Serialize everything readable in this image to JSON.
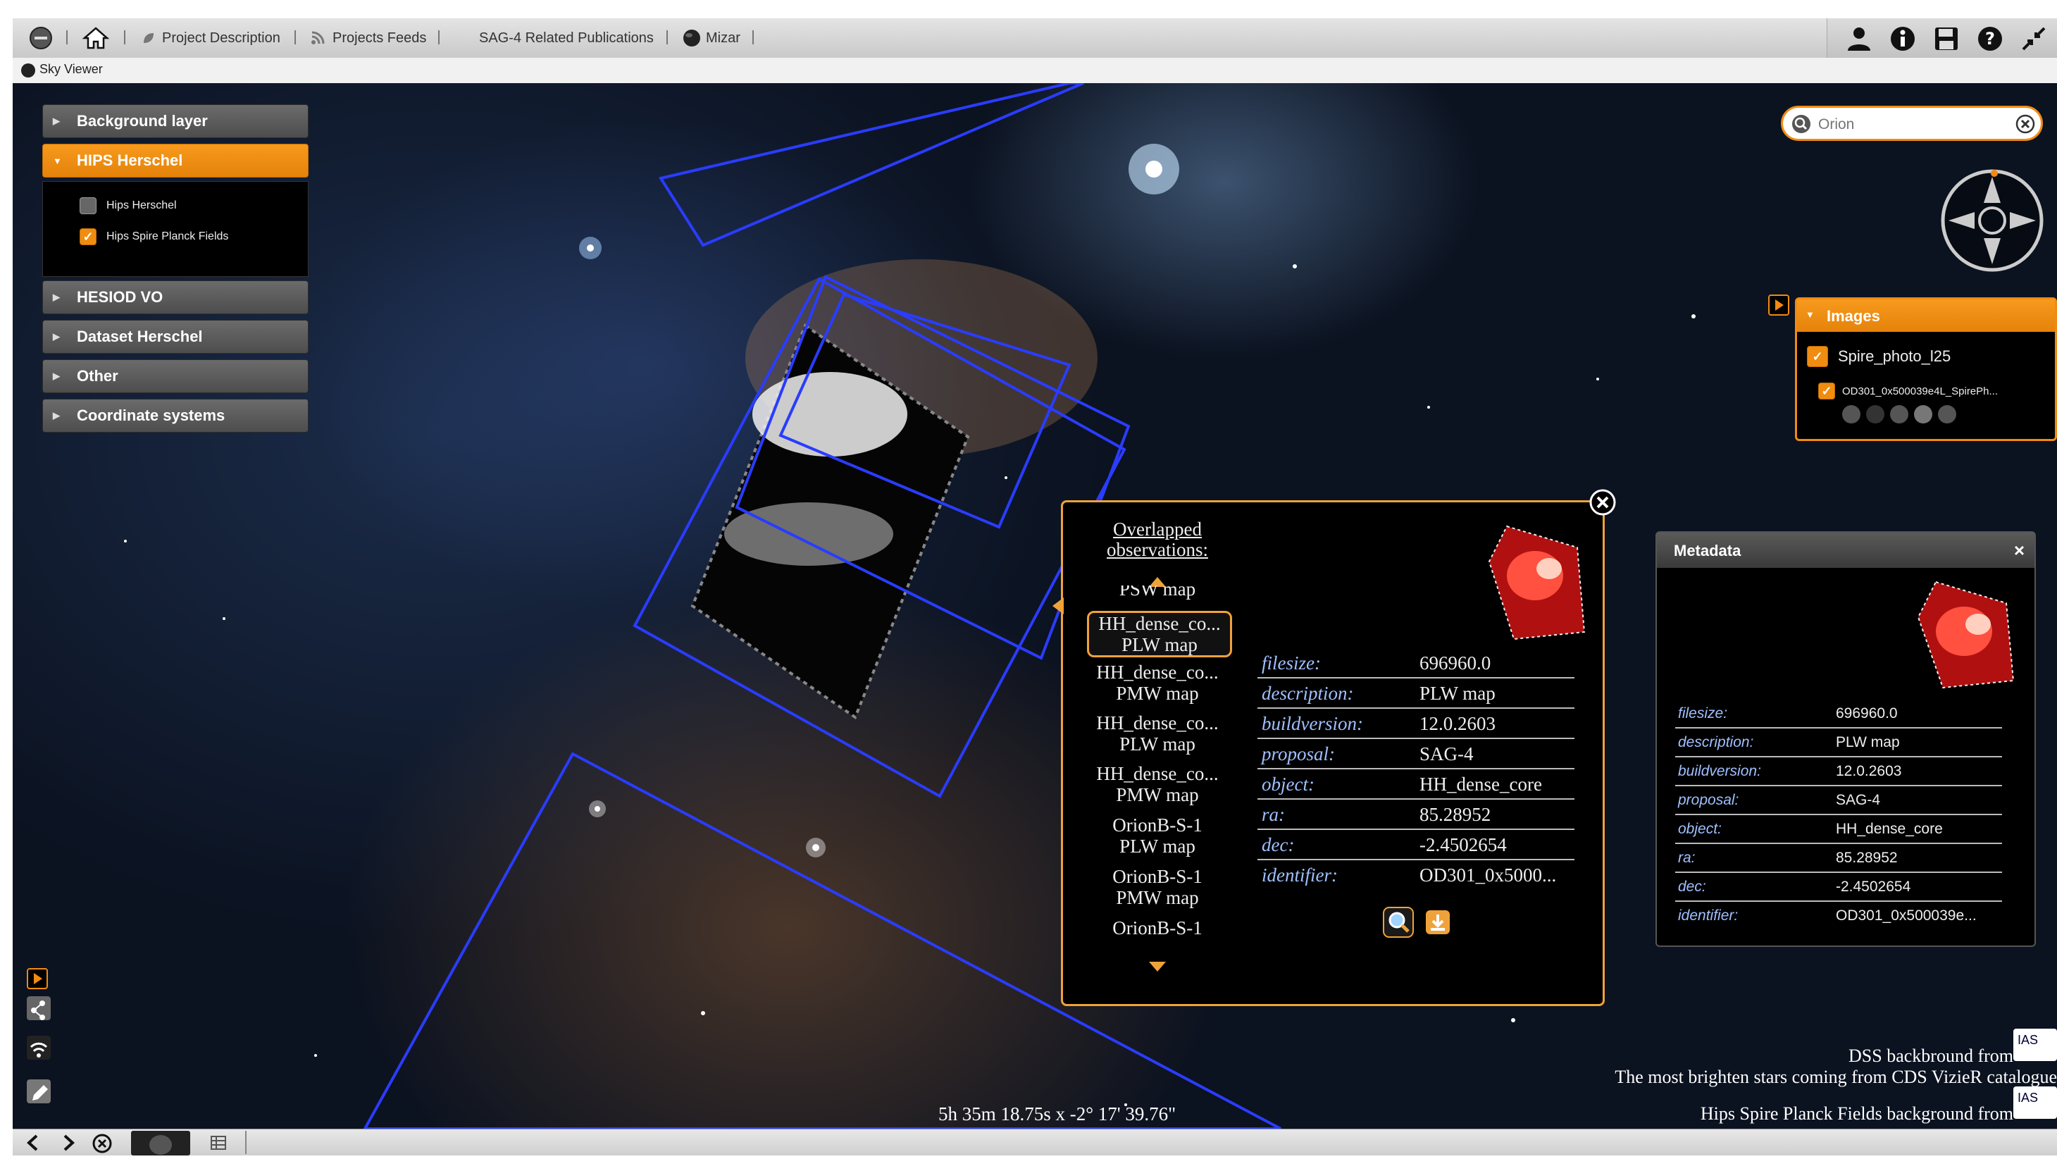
{
  "toolbar": {
    "nav": [
      {
        "label": "Project Description",
        "icon": "leaf-icon"
      },
      {
        "label": "Projects Feeds",
        "icon": "rss-icon"
      },
      {
        "label": "SAG-4 Related Publications",
        "icon": ""
      },
      {
        "label": "Mizar",
        "icon": "globe-icon"
      }
    ],
    "right_icons": [
      "user-icon",
      "info-icon",
      "save-icon",
      "help-icon",
      "fullscreen-icon"
    ]
  },
  "subbar": {
    "label": "Sky Viewer"
  },
  "layers": {
    "items": [
      {
        "label": "Background layer",
        "expanded": false
      },
      {
        "label": "HIPS Herschel",
        "expanded": true
      },
      {
        "label": "HESIOD VO",
        "expanded": false
      },
      {
        "label": "Dataset Herschel",
        "expanded": false
      },
      {
        "label": "Other",
        "expanded": false
      },
      {
        "label": "Coordinate systems",
        "expanded": false
      }
    ],
    "hips_children": [
      {
        "label": "Hips Herschel",
        "checked": false
      },
      {
        "label": "Hips Spire Planck Fields",
        "checked": true
      }
    ]
  },
  "search": {
    "placeholder": "Orion"
  },
  "images_panel": {
    "title": "Images",
    "group": "Spire_photo_l25",
    "item": "OD301_0x500039e4L_SpirePh..."
  },
  "popup": {
    "title": "Overlapped observations:",
    "list": [
      {
        "line1": "PSW map",
        "line2": "",
        "selected": false,
        "partial": true
      },
      {
        "line1": "HH_dense_co...",
        "line2": "PLW map",
        "selected": true
      },
      {
        "line1": "HH_dense_co...",
        "line2": "PMW map",
        "selected": false
      },
      {
        "line1": "HH_dense_co...",
        "line2": "PLW map",
        "selected": false
      },
      {
        "line1": "HH_dense_co...",
        "line2": "PMW map",
        "selected": false
      },
      {
        "line1": "OrionB-S-1",
        "line2": "PLW map",
        "selected": false
      },
      {
        "line1": "OrionB-S-1",
        "line2": "PMW map",
        "selected": false
      },
      {
        "line1": "OrionB-S-1",
        "line2": "",
        "selected": false
      }
    ],
    "metadata": [
      {
        "key": "filesize:",
        "value": "696960.0"
      },
      {
        "key": "description:",
        "value": "PLW map"
      },
      {
        "key": "buildversion:",
        "value": "12.0.2603"
      },
      {
        "key": "proposal:",
        "value": "SAG-4"
      },
      {
        "key": "object:",
        "value": "HH_dense_core"
      },
      {
        "key": "ra:",
        "value": "85.28952"
      },
      {
        "key": "dec:",
        "value": "-2.4502654"
      },
      {
        "key": "identifier:",
        "value": "OD301_0x5000..."
      }
    ]
  },
  "metadata_panel": {
    "title": "Metadata",
    "rows": [
      {
        "key": "filesize:",
        "value": "696960.0"
      },
      {
        "key": "description:",
        "value": "PLW map"
      },
      {
        "key": "buildversion:",
        "value": "12.0.2603"
      },
      {
        "key": "proposal:",
        "value": "SAG-4"
      },
      {
        "key": "object:",
        "value": "HH_dense_core"
      },
      {
        "key": "ra:",
        "value": "85.28952"
      },
      {
        "key": "dec:",
        "value": "-2.4502654"
      },
      {
        "key": "identifier:",
        "value": "OD301_0x500039e..."
      }
    ]
  },
  "credits": {
    "line1": "DSS backbround from",
    "line2": "The most brighten stars coming from CDS VizieR catalogue",
    "line3": "Hips Spire Planck Fields background from",
    "logo_text": "IAS"
  },
  "coordinates": "5h 35m 18.75s x -2° 17' 39.76\"",
  "colors": {
    "accent": "#f28a12",
    "footprint": "#2a3cff",
    "meta_key": "#9fc0ff"
  }
}
